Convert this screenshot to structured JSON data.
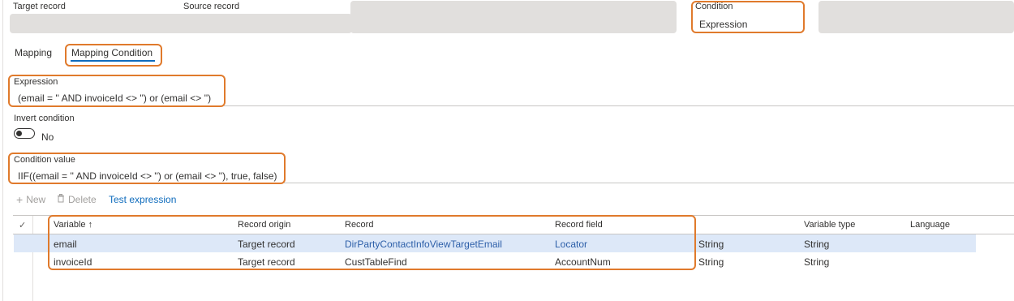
{
  "top": {
    "target_record_label": "Target record",
    "source_record_label": "Source record",
    "condition_label": "Condition",
    "condition_value": "Expression"
  },
  "tabs": [
    {
      "label": "Mapping"
    },
    {
      "label": "Mapping Condition"
    }
  ],
  "expression": {
    "label": "Expression",
    "value": "(email = '' AND invoiceId <> '') or (email <> '')"
  },
  "invert": {
    "label": "Invert condition",
    "value": "No"
  },
  "condition_value": {
    "label": "Condition value",
    "value": "IIF((email = '' AND invoiceId <> '') or (email <> ''), true, false)"
  },
  "toolbar": {
    "new_label": "New",
    "delete_label": "Delete",
    "test_label": "Test expression"
  },
  "grid": {
    "columns": [
      "Variable ↑",
      "Record origin",
      "Record",
      "Record field",
      "",
      "Variable type",
      "Language"
    ],
    "rows": [
      {
        "variable": "email",
        "origin": "Target record",
        "record": "DirPartyContactInfoViewTargetEmail",
        "field": "Locator",
        "type1": "String",
        "type2": "String",
        "selected": true
      },
      {
        "variable": "invoiceId",
        "origin": "Target record",
        "record": "CustTableFind",
        "field": "AccountNum",
        "type1": "String",
        "type2": "String",
        "selected": false
      }
    ]
  },
  "colors": {
    "accent": "#0f6cbd",
    "highlight": "#e07a2c",
    "link": "#2c5ea8",
    "selected_row": "#dde8f8"
  }
}
